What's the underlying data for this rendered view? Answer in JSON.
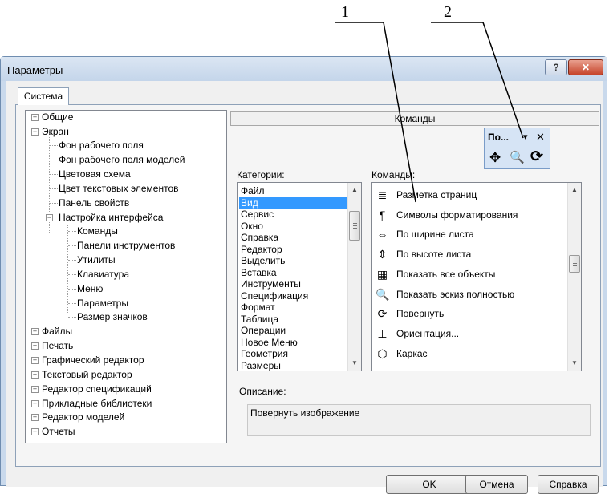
{
  "annotations": {
    "a1": "1",
    "a2": "2"
  },
  "window": {
    "title": "Параметры",
    "help_glyph": "?",
    "close_glyph": "✕"
  },
  "tab": {
    "label": "Система"
  },
  "tree": {
    "obschie": "Общие",
    "ekran": "Экран",
    "fon": "Фон рабочего поля",
    "fon_models": "Фон рабочего поля моделей",
    "color_scheme": "Цветовая схема",
    "text_color": "Цвет текстовых элементов",
    "props_panel": "Панель свойств",
    "iface": "Настройка интерфейса",
    "commands": "Команды",
    "toolbars": "Панели инструментов",
    "utils": "Утилиты",
    "keyboard": "Клавиатура",
    "menu": "Меню",
    "params": "Параметры",
    "icon_size": "Размер значков",
    "files": "Файлы",
    "print": "Печать",
    "graph_editor": "Графический редактор",
    "text_editor": "Текстовый редактор",
    "spec_editor": "Редактор спецификаций",
    "libs": "Прикладные библиотеки",
    "model_editor": "Редактор моделей",
    "reports": "Отчеты"
  },
  "commands_header": "Команды",
  "categories_label": "Категории:",
  "commands_label": "Команды:",
  "categories": [
    "Файл",
    "Вид",
    "Сервис",
    "Окно",
    "Справка",
    "Редактор",
    "Выделить",
    "Вставка",
    "Инструменты",
    "Спецификация",
    "Формат",
    "Таблица",
    "Операции",
    "Новое Меню",
    "Геометрия",
    "Размеры"
  ],
  "selected_category": "Вид",
  "commands": [
    {
      "icon": "page-layout-icon",
      "glyph": "≣",
      "label": "Разметка страниц"
    },
    {
      "icon": "pilcrow-icon",
      "glyph": "¶",
      "label": "Символы форматирования"
    },
    {
      "icon": "fit-width-icon",
      "glyph": "⇔",
      "label": "По ширине листа"
    },
    {
      "icon": "fit-height-icon",
      "glyph": "⇕",
      "label": "По высоте листа"
    },
    {
      "icon": "show-all-icon",
      "glyph": "▦",
      "label": "Показать все объекты"
    },
    {
      "icon": "zoom-fit-icon",
      "glyph": "🔍",
      "label": "Показать эскиз полностью"
    },
    {
      "icon": "rotate-icon",
      "glyph": "⟳",
      "label": "Повернуть"
    },
    {
      "icon": "orientation-icon",
      "glyph": "⊥",
      "label": "Ориентация..."
    },
    {
      "icon": "wireframe-icon",
      "glyph": "⬡",
      "label": "Каркас"
    }
  ],
  "description_label": "Описание:",
  "description_text": "Повернуть изображение",
  "mini_toolbar": {
    "title": "По...",
    "pin_glyph": "▾",
    "close_glyph": "✕",
    "move_glyph": "✥",
    "zoom_glyph": "🔍",
    "rotate_glyph": "⟳"
  },
  "buttons": {
    "ok": "OK",
    "cancel": "Отмена",
    "help": "Справка"
  }
}
